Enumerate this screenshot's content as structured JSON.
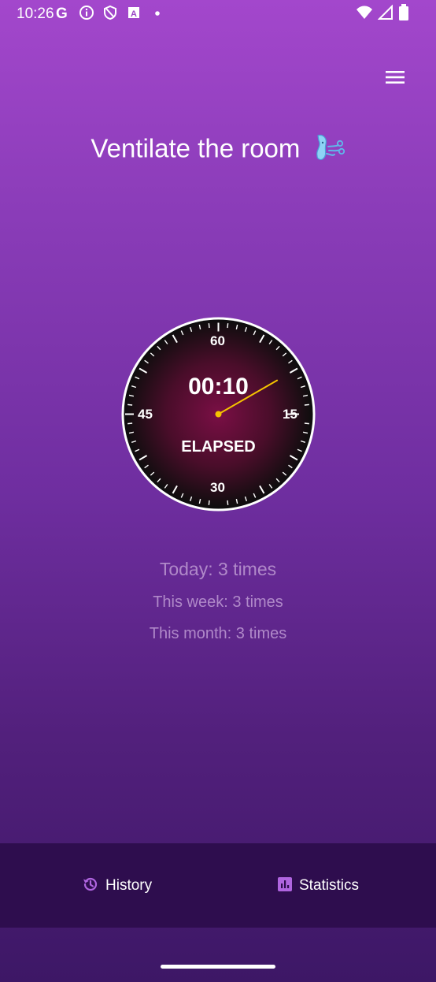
{
  "status_bar": {
    "time": "10:26",
    "left_icons": [
      "google-icon",
      "info-icon",
      "shield-icon",
      "text-a-icon",
      "dot-icon"
    ],
    "right_icons": [
      "wifi-icon",
      "signal-icon",
      "battery-icon"
    ]
  },
  "header": {
    "menu_icon": "menu-icon",
    "title": "Ventilate the room",
    "title_emoji": "wind-face-emoji"
  },
  "timer": {
    "elapsed": "00:10",
    "label": "ELAPSED",
    "dial_labels": {
      "top": "60",
      "right": "15",
      "bottom": "30",
      "left": "45"
    },
    "hand_position_fraction": 0.167,
    "colors": {
      "hand": "#f5c400",
      "face_center": "#7a0f45",
      "face_edge": "#0d0d0d",
      "rim": "#ffffff"
    }
  },
  "stats": {
    "today": "Today: 3 times",
    "week": "This week: 3 times",
    "month": "This month: 3 times"
  },
  "bottom_nav": {
    "items": [
      {
        "label": "History",
        "icon": "history-icon"
      },
      {
        "label": "Statistics",
        "icon": "bar-chart-icon"
      }
    ],
    "colors": {
      "accent": "#b065e0",
      "background": "#2e0d4e"
    }
  }
}
